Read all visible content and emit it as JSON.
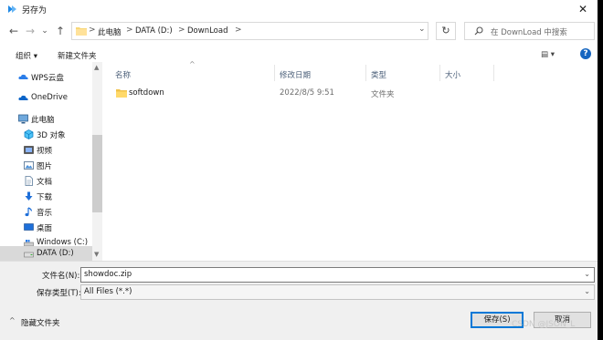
{
  "window": {
    "title": "另存为",
    "close_glyph": "✕"
  },
  "nav_buttons": {
    "back": "←",
    "forward": "→",
    "dropdown": "⌄",
    "up": "↑"
  },
  "address": {
    "crumbs": [
      "此电脑",
      "DATA (D:)",
      "DownLoad"
    ],
    "separator": ">",
    "dropdown": "⌄"
  },
  "refresh": "↻",
  "search": {
    "placeholder": "在 DownLoad 中搜索"
  },
  "toolbar": {
    "organize": "组织 ▾",
    "new_folder": "新建文件夹",
    "view_glyph": "▤ ▾",
    "help": "?"
  },
  "sidebar": {
    "items": [
      {
        "label": "WPS云盘",
        "icon": "cloud-icon"
      },
      {
        "label": "OneDrive",
        "icon": "onedrive-icon"
      },
      {
        "label": "此电脑",
        "icon": "computer-icon"
      },
      {
        "label": "3D 对象",
        "icon": "cube-icon"
      },
      {
        "label": "视频",
        "icon": "video-icon"
      },
      {
        "label": "图片",
        "icon": "picture-icon"
      },
      {
        "label": "文档",
        "icon": "document-icon"
      },
      {
        "label": "下载",
        "icon": "download-icon"
      },
      {
        "label": "音乐",
        "icon": "music-icon"
      },
      {
        "label": "桌面",
        "icon": "desktop-icon"
      },
      {
        "label": "Windows (C:)",
        "icon": "drive-icon"
      },
      {
        "label": "DATA (D:)",
        "icon": "drive-icon"
      }
    ]
  },
  "columns": {
    "name": "名称",
    "modified": "修改日期",
    "type": "类型",
    "size": "大小",
    "sort_glyph": "^"
  },
  "files": [
    {
      "name": "softdown",
      "modified": "2022/8/5 9:51",
      "type": "文件夹",
      "size": ""
    }
  ],
  "form": {
    "filename_label": "文件名(N):",
    "filename_value": "showdoc.zip",
    "filetype_label": "保存类型(T):",
    "filetype_value": "All Files (*.*)"
  },
  "footer": {
    "hide_folders": "隐藏文件夹",
    "hide_glyph": "^",
    "save": "保存(S)",
    "cancel": "取消"
  },
  "watermark": "CSDN @JSON_L"
}
